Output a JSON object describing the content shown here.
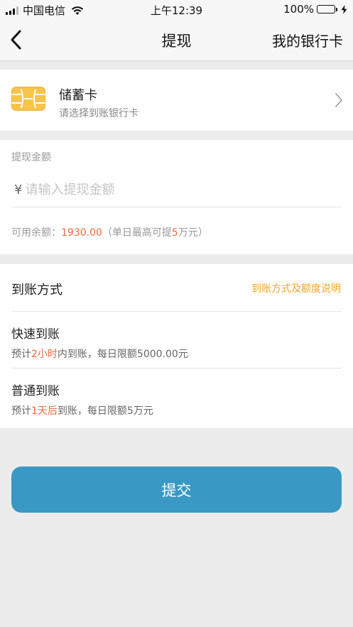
{
  "status_bar": {
    "carrier": "中国电信",
    "time": "上午12:39",
    "battery_percent": "100%",
    "battery_level": 1.0,
    "signal_bars": 3
  },
  "nav": {
    "title": "提现",
    "right_link": "我的银行卡"
  },
  "card": {
    "name": "储蓄卡",
    "subtitle": "请选择到账银行卡"
  },
  "amount": {
    "label": "提现金额",
    "currency_symbol": "¥",
    "placeholder": "请输入提现金额",
    "value": "",
    "balance_prefix": "可用余额：",
    "balance_value": "1930.00",
    "limit_prefix": "（单日最高可提",
    "limit_number": "5",
    "limit_suffix": "万元）"
  },
  "method": {
    "header": "到账方式",
    "help_link": "到账方式及额度说明",
    "options": [
      {
        "title": "快速到账",
        "desc_prefix": "预计",
        "desc_highlight": "2小时",
        "desc_suffix": "内到账，每日限额5000.00元"
      },
      {
        "title": "普通到账",
        "desc_prefix": "预计",
        "desc_highlight": "1天后",
        "desc_suffix": "到账，每日限额5万元"
      }
    ]
  },
  "submit_label": "提交",
  "colors": {
    "primary_button": "#3a98c4",
    "highlight_orange": "#f06a3a",
    "link_yellow": "#f5a623",
    "battery_green": "#3bd35b"
  },
  "icons": {
    "back": "chevron-left-icon",
    "card": "bank-card-chip-icon",
    "card_arrow": "chevron-right-icon",
    "wifi": "wifi-icon",
    "charging": "charging-bolt-icon"
  }
}
